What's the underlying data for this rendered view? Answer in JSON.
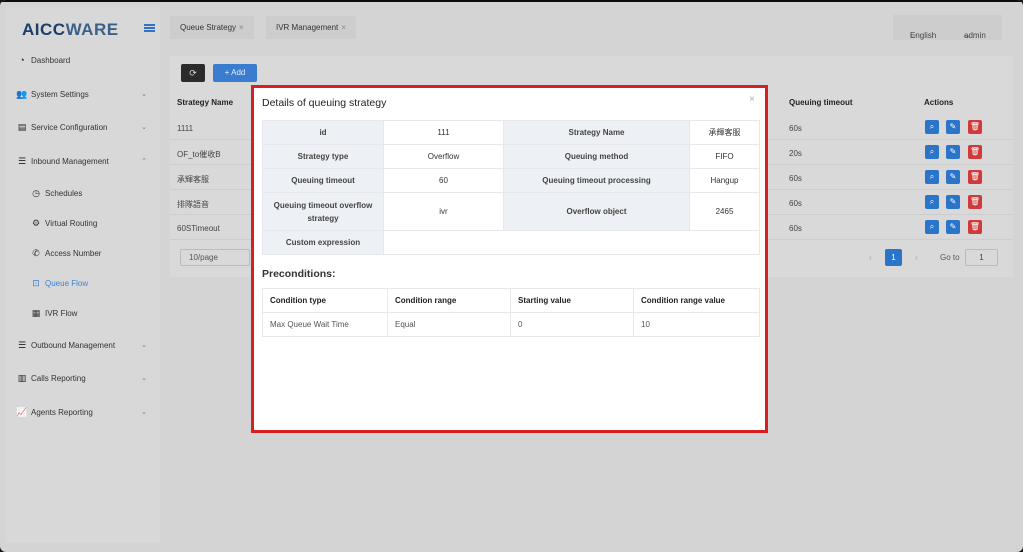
{
  "app": {
    "logo_main": "AICC",
    "logo_accent": "WARE"
  },
  "sidebar": {
    "items": [
      {
        "label": "Dashboard",
        "icon": "dashboard-icon",
        "glyph": "◔"
      },
      {
        "label": "System Settings",
        "icon": "users-icon",
        "glyph": "👥"
      },
      {
        "label": "Service Configuration",
        "icon": "id-card-icon",
        "glyph": "▤"
      },
      {
        "label": "Inbound Management",
        "icon": "list-icon",
        "glyph": "☰"
      },
      {
        "label": "Outbound Management",
        "icon": "list-icon",
        "glyph": "☰"
      },
      {
        "label": "Calls Reporting",
        "icon": "bar-chart-icon",
        "glyph": "▥"
      },
      {
        "label": "Agents Reporting",
        "icon": "line-chart-icon",
        "glyph": "📈"
      }
    ],
    "sub_items": [
      {
        "label": "Schedules",
        "icon": "clock-icon",
        "glyph": "◷"
      },
      {
        "label": "Virtual Routing",
        "icon": "gear-icon",
        "glyph": "⚙"
      },
      {
        "label": "Access Number",
        "icon": "phone-icon",
        "glyph": "✆"
      },
      {
        "label": "Queue Flow",
        "icon": "queue-icon",
        "glyph": "⊡"
      },
      {
        "label": "IVR Flow",
        "icon": "ivr-icon",
        "glyph": "▦"
      }
    ]
  },
  "tabs": [
    {
      "label": "Queue Strategy",
      "close": "×"
    },
    {
      "label": "IVR Management",
      "close": "×"
    }
  ],
  "header": {
    "language": "English",
    "user": "admin"
  },
  "toolbar": {
    "refresh_glyph": "⟳",
    "add_label": "+ Add"
  },
  "list": {
    "columns": {
      "name": "Strategy Name",
      "timeout": "Queuing timeout",
      "actions": "Actions"
    },
    "rows": [
      {
        "name": "1111",
        "timeout": "60s"
      },
      {
        "name": "OF_to催收B",
        "timeout": "20s"
      },
      {
        "name": "承輝客服",
        "timeout": "60s"
      },
      {
        "name": "排隊語音",
        "timeout": "60s"
      },
      {
        "name": "60STimeout",
        "timeout": "60s"
      }
    ],
    "page_size": "10/page",
    "current_page": "1",
    "goto_label": "Go to",
    "goto_value": "1"
  },
  "modal": {
    "title": "Details of queuing strategy",
    "close": "×",
    "details": {
      "id_key": "id",
      "id_val": "111",
      "name_key": "Strategy Name",
      "name_val": "承輝客服",
      "type_key": "Strategy type",
      "type_val": "Overflow",
      "method_key": "Queuing method",
      "method_val": "FIFO",
      "timeout_key": "Queuing timeout",
      "timeout_val": "60",
      "processing_key": "Queuing timeout processing",
      "processing_val": "Hangup",
      "overflow_strategy_key": "Queuing timeout overflow strategy",
      "overflow_strategy_val": "ivr",
      "overflow_object_key": "Overflow object",
      "overflow_object_val": "2465",
      "custom_key": "Custom expression",
      "custom_val": ""
    },
    "preconditions_title": "Preconditions:",
    "preconditions": {
      "headers": [
        "Condition type",
        "Condition range",
        "Starting value",
        "Condition range value"
      ],
      "rows": [
        [
          "Max Queue Wait Time",
          "Equal",
          "0",
          "10"
        ]
      ]
    }
  }
}
